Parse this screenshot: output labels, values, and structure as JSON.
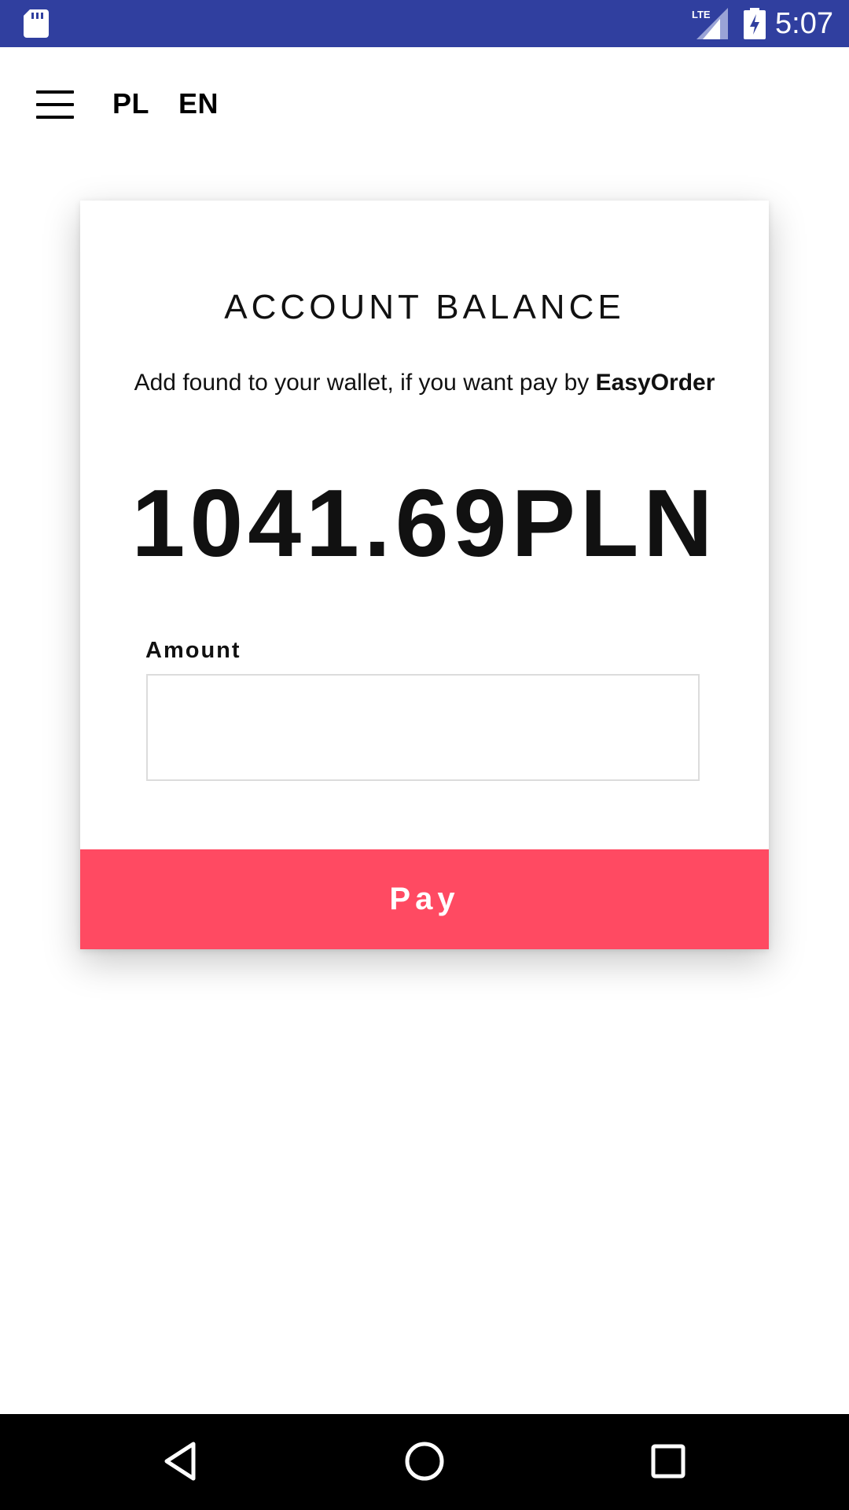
{
  "status_bar": {
    "time": "5:07",
    "network_label": "LTE",
    "icons": [
      "sd-card-icon",
      "lte-signal-icon",
      "battery-charging-icon"
    ],
    "background_color": "#303f9f"
  },
  "top_bar": {
    "menu_icon": "hamburger-menu-icon",
    "languages": [
      "PL",
      "EN"
    ]
  },
  "card": {
    "title": "ACCOUNT BALANCE",
    "subtitle_prefix": "Add found to your wallet, if you want pay by ",
    "subtitle_brand": "EasyOrder",
    "balance": "1041.69PLN",
    "amount_label": "Amount",
    "amount_value": "",
    "pay_label": "Pay",
    "pay_color": "#ff4a62"
  },
  "nav_bar": {
    "icons": [
      "back-icon",
      "home-icon",
      "recents-icon"
    ]
  }
}
